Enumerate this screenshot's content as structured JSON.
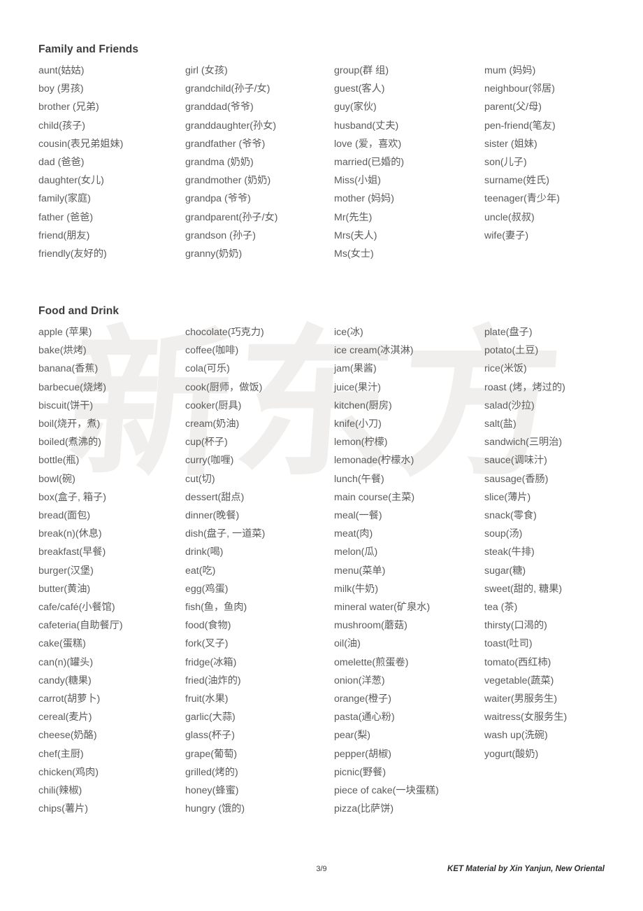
{
  "document": {
    "watermark_text": "新东方",
    "watermark_color": "#f0efed",
    "text_color": "#5b5b5b",
    "heading_color": "#3d3d3d"
  },
  "sections": [
    {
      "id": "family",
      "title": "Family and Friends",
      "columns": [
        [
          "aunt(姑姑)",
          "boy (男孩)",
          "brother (兄弟)",
          "child(孩子)",
          "cousin(表兄弟姐妹)",
          "dad (爸爸)",
          "daughter(女儿)",
          "family(家庭)",
          "father (爸爸)",
          "friend(朋友)",
          "friendly(友好的)"
        ],
        [
          "girl (女孩)",
          "grandchild(孙子/女)",
          "granddad(爷爷)",
          "granddaughter(孙女)",
          "grandfather (爷爷)",
          "grandma (奶奶)",
          "grandmother (奶奶)",
          "grandpa (爷爷)",
          "grandparent(孙子/女)",
          "grandson (孙子)",
          "granny(奶奶)"
        ],
        [
          "group(群 组)",
          "guest(客人)",
          "guy(家伙)",
          "husband(丈夫)",
          "love (爱，喜欢)",
          "married(已婚的)",
          "Miss(小姐)",
          "mother (妈妈)",
          "Mr(先生)",
          "Mrs(夫人)",
          "Ms(女士)"
        ],
        [
          "mum (妈妈)",
          "neighbour(邻居)",
          "parent(父/母)",
          "pen-friend(笔友)",
          "sister (姐妹)",
          "son(儿子)",
          "surname(姓氏)",
          "teenager(青少年)",
          "uncle(叔叔)",
          "wife(妻子)"
        ]
      ]
    },
    {
      "id": "food",
      "title": "Food and Drink",
      "columns": [
        [
          "apple (苹果)",
          "bake(烘烤)",
          "banana(香蕉)",
          "barbecue(烧烤)",
          "biscuit(饼干)",
          "boil(烧开，煮)",
          "boiled(煮沸的)",
          "bottle(瓶)",
          "bowl(碗)",
          "box(盒子, 箱子)",
          "bread(面包)",
          "break(n)(休息)",
          "breakfast(早餐)",
          "burger(汉堡)",
          "butter(黄油)",
          "cafe/café(小餐馆)",
          "cafeteria(自助餐厅)",
          "cake(蛋糕)",
          "can(n)(罐头)",
          "candy(糖果)",
          "carrot(胡萝卜)",
          "cereal(麦片)",
          "cheese(奶酪)",
          "chef(主厨)",
          "chicken(鸡肉)",
          "chili(辣椒)",
          "chips(薯片)"
        ],
        [
          "chocolate(巧克力)",
          "coffee(咖啡)",
          "cola(可乐)",
          "cook(厨师，做饭)",
          "cooker(厨具)",
          "cream(奶油)",
          "cup(杯子)",
          "curry(咖喱)",
          "cut(切)",
          "dessert(甜点)",
          "dinner(晚餐)",
          "dish(盘子, 一道菜)",
          "drink(喝)",
          "eat(吃)",
          "egg(鸡蛋)",
          "fish(鱼，鱼肉)",
          "food(食物)",
          "fork(叉子)",
          "fridge(冰箱)",
          "fried(油炸的)",
          "fruit(水果)",
          "garlic(大蒜)",
          "glass(杯子)",
          "grape(葡萄)",
          "grilled(烤的)",
          "honey(蜂蜜)",
          "hungry (饿的)"
        ],
        [
          "ice(冰)",
          "ice cream(冰淇淋)",
          "jam(果酱)",
          "juice(果汁)",
          "kitchen(厨房)",
          "knife(小刀)",
          "lemon(柠檬)",
          "lemonade(柠檬水)",
          "lunch(午餐)",
          "main course(主菜)",
          "meal(一餐)",
          "meat(肉)",
          "melon(瓜)",
          "menu(菜单)",
          "milk(牛奶)",
          "mineral water(矿泉水)",
          "mushroom(蘑菇)",
          "oil(油)",
          "omelette(煎蛋卷)",
          "onion(洋葱)",
          "orange(橙子)",
          "pasta(通心粉)",
          "pear(梨)",
          "pepper(胡椒)",
          "picnic(野餐)",
          "piece of cake(一块蛋糕)",
          "pizza(比萨饼)"
        ],
        [
          "plate(盘子)",
          "potato(土豆)",
          "rice(米饭)",
          "roast (烤，烤过的)",
          "salad(沙拉)",
          "salt(盐)",
          "sandwich(三明治)",
          "sauce(调味汁)",
          "sausage(香肠)",
          "slice(薄片)",
          "snack(零食)",
          "soup(汤)",
          "steak(牛排)",
          "sugar(糖)",
          "sweet(甜的, 糖果)",
          "tea (茶)",
          "thirsty(口渴的)",
          "toast(吐司)",
          "tomato(西红柿)",
          "vegetable(蔬菜)",
          "waiter(男服务生)",
          "waitress(女服务生)",
          "wash up(洗碗)",
          "yogurt(酸奶)"
        ]
      ]
    }
  ],
  "footer": {
    "page_number": "3/9",
    "credit": "KET Material by Xin Yanjun, New Oriental"
  }
}
